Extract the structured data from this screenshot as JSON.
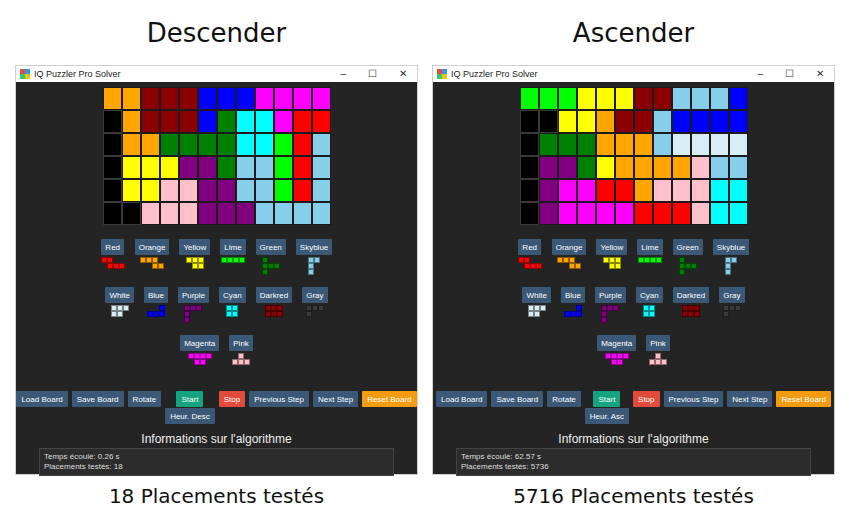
{
  "panels": [
    {
      "heading": "Descender",
      "window": {
        "title": "IQ Puzzler Pro Solver",
        "controls": [
          "–",
          "☐",
          "✕"
        ]
      },
      "board": {
        "rows": [
          [
            "#ffa500",
            "#ffa500",
            "#8b0000",
            "#8b0000",
            "#8b0000",
            "#0000ff",
            "#0000ff",
            "#0000ff",
            "#ff00ff",
            "#ff00ff",
            "#ff00ff",
            "#ff00ff"
          ],
          [
            null,
            "#ffa500",
            "#8b0000",
            "#8b0000",
            "#8b0000",
            "#0000ff",
            "#008000",
            "#00ffff",
            "#00ffff",
            "#ff00ff",
            "#ff0000",
            "#ff0000"
          ],
          [
            null,
            "#ffa500",
            "#ffa500",
            "#008000",
            "#008000",
            "#008000",
            "#008000",
            "#00ffff",
            "#00ffff",
            "#00ff00",
            "#ff0000",
            "#87ceeb"
          ],
          [
            null,
            "#ffff00",
            "#ffff00",
            "#ffff00",
            "#800080",
            "#800080",
            "#008000",
            "#87ceeb",
            "#87ceeb",
            "#00ff00",
            "#ff0000",
            "#87ceeb"
          ],
          [
            null,
            "#ffff00",
            "#ffff00",
            "#ffc0cb",
            "#ffc0cb",
            "#800080",
            "#800080",
            "#87ceeb",
            "#87ceeb",
            "#00ff00",
            "#ff0000",
            "#87ceeb"
          ],
          [
            null,
            null,
            "#ffc0cb",
            "#ffc0cb",
            "#ffc0cb",
            "#800080",
            "#800080",
            "#800080",
            "#87ceeb",
            "#87ceeb",
            "#87ceeb",
            "#87ceeb"
          ]
        ]
      },
      "pieces": [
        {
          "label": "Red",
          "color": "#ff0000"
        },
        {
          "label": "Orange",
          "color": "#ffa500"
        },
        {
          "label": "Yellow",
          "color": "#ffff00"
        },
        {
          "label": "Lime",
          "color": "#00ff00"
        },
        {
          "label": "Green",
          "color": "#008000"
        },
        {
          "label": "Skyblue",
          "color": "#87ceeb"
        },
        {
          "label": "White",
          "color": "#d8eef6"
        },
        {
          "label": "Blue",
          "color": "#0000ff"
        },
        {
          "label": "Purple",
          "color": "#800080"
        },
        {
          "label": "Cyan",
          "color": "#00ffff"
        },
        {
          "label": "Darkred",
          "color": "#8b0000"
        },
        {
          "label": "Gray",
          "color": "#3a3a3a"
        },
        {
          "label": "Magenta",
          "color": "#ff00ff"
        },
        {
          "label": "Pink",
          "color": "#ffc0cb"
        }
      ],
      "buttons": [
        {
          "label": "Load Board",
          "color": "#3b5877"
        },
        {
          "label": "Save Board",
          "color": "#3b5877"
        },
        {
          "label": "Rotate",
          "color": "#3b5877"
        },
        {
          "label": "Start",
          "color": "#16a37f",
          "below": {
            "label": "Heur. Desc",
            "color": "#3b5877"
          }
        },
        {
          "label": "Stop",
          "color": "#e04b3c"
        },
        {
          "label": "Previous Step",
          "color": "#3b5877"
        },
        {
          "label": "Next Step",
          "color": "#3b5877"
        },
        {
          "label": "Reset Board",
          "color": "#f39c12"
        }
      ],
      "info": {
        "title": "Informations sur l'algorithme",
        "lines": [
          "Temps écoulé: 0.26 s",
          "Placements testés: 18"
        ]
      },
      "caption": "18 Placements testés"
    },
    {
      "heading": "Ascender",
      "window": {
        "title": "IQ Puzzler Pro Solver",
        "controls": [
          "–",
          "☐",
          "✕"
        ]
      },
      "board": {
        "rows": [
          [
            "#00ff00",
            "#00ff00",
            "#00ff00",
            "#ffff00",
            "#ffff00",
            "#ffff00",
            "#8b0000",
            "#8b0000",
            "#87ceeb",
            "#87ceeb",
            "#87ceeb",
            "#0000ff"
          ],
          [
            null,
            null,
            "#ffff00",
            "#ffff00",
            "#ffa500",
            "#8b0000",
            "#8b0000",
            "#87ceeb",
            "#0000ff",
            "#0000ff",
            "#0000ff",
            "#0000ff"
          ],
          [
            null,
            "#008000",
            "#008000",
            "#008000",
            "#ffa500",
            "#ffa500",
            "#ffa500",
            "#87ceeb",
            "#d8eef6",
            "#d8eef6",
            "#d8eef6",
            "#d8eef6"
          ],
          [
            null,
            "#800080",
            "#800080",
            "#008000",
            "#ffff00",
            "#ffa500",
            "#ffa500",
            "#ffa500",
            "#ffa500",
            "#ffc0cb",
            "#87ceeb",
            "#87ceeb"
          ],
          [
            null,
            "#800080",
            "#ff00ff",
            "#ff00ff",
            "#ff0000",
            "#ff0000",
            "#ffa500",
            "#ffc0cb",
            "#ffc0cb",
            "#ffc0cb",
            "#00ffff",
            "#00ffff"
          ],
          [
            null,
            "#800080",
            "#ff00ff",
            "#ff00ff",
            "#ff00ff",
            "#ff00ff",
            "#ff0000",
            "#ff0000",
            "#ff0000",
            "#ffc0cb",
            "#00ffff",
            "#00ffff"
          ]
        ]
      },
      "pieces": [
        {
          "label": "Red",
          "color": "#ff0000"
        },
        {
          "label": "Orange",
          "color": "#ffa500"
        },
        {
          "label": "Yellow",
          "color": "#ffff00"
        },
        {
          "label": "Lime",
          "color": "#00ff00"
        },
        {
          "label": "Green",
          "color": "#008000"
        },
        {
          "label": "Skyblue",
          "color": "#87ceeb"
        },
        {
          "label": "White",
          "color": "#d8eef6"
        },
        {
          "label": "Blue",
          "color": "#0000ff"
        },
        {
          "label": "Purple",
          "color": "#800080"
        },
        {
          "label": "Cyan",
          "color": "#00ffff"
        },
        {
          "label": "Darkred",
          "color": "#8b0000"
        },
        {
          "label": "Gray",
          "color": "#3a3a3a"
        },
        {
          "label": "Magenta",
          "color": "#ff00ff"
        },
        {
          "label": "Pink",
          "color": "#ffc0cb"
        }
      ],
      "buttons": [
        {
          "label": "Load Board",
          "color": "#3b5877"
        },
        {
          "label": "Save Board",
          "color": "#3b5877"
        },
        {
          "label": "Rotate",
          "color": "#3b5877"
        },
        {
          "label": "Start",
          "color": "#16a37f",
          "below": {
            "label": "Heur. Asc",
            "color": "#3b5877"
          }
        },
        {
          "label": "Stop",
          "color": "#e04b3c"
        },
        {
          "label": "Previous Step",
          "color": "#3b5877"
        },
        {
          "label": "Next Step",
          "color": "#3b5877"
        },
        {
          "label": "Reset Board",
          "color": "#f39c12"
        }
      ],
      "info": {
        "title": "Informations sur l'algorithme",
        "lines": [
          "Temps écoulé: 62.57 s",
          "Placements testés: 5736"
        ]
      },
      "caption": "5716 Placements testés"
    }
  ]
}
